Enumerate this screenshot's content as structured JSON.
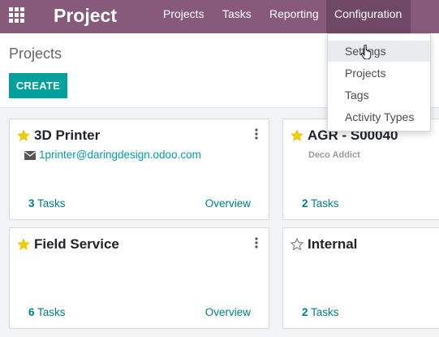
{
  "navbar": {
    "app_name": "Project",
    "menu": [
      "Projects",
      "Tasks",
      "Reporting",
      "Configuration"
    ],
    "color": "#875a7b"
  },
  "control_panel": {
    "breadcrumb": "Projects",
    "create_label": "CREATE"
  },
  "config_dropdown": {
    "items": [
      "Settings",
      "Projects",
      "Tags",
      "Activity Types"
    ],
    "hovered": "Settings"
  },
  "projects": [
    {
      "title": "3D Printer",
      "favorite": true,
      "email": "1printer@daringdesign.odoo.com",
      "partner": "",
      "task_count": "3",
      "task_word": "Tasks",
      "overview": "Overview"
    },
    {
      "title": "AGR - S00040",
      "favorite": true,
      "email": "",
      "partner": "Deco Addict",
      "task_count": "2",
      "task_word": "Tasks",
      "overview": ""
    },
    {
      "title": "Field Service",
      "favorite": true,
      "email": "",
      "partner": "",
      "task_count": "6",
      "task_word": "Tasks",
      "overview": "Overview"
    },
    {
      "title": "Internal",
      "favorite": false,
      "email": "",
      "partner": "",
      "task_count": "2",
      "task_word": "Tasks",
      "overview": ""
    }
  ],
  "colors": {
    "accent": "#00a09d",
    "link": "#017e84",
    "star": "#f3cc00"
  },
  "icons": [
    "apps-grid-icon",
    "star-icon",
    "kebab-menu-icon",
    "envelope-icon",
    "hand-pointer-icon"
  ]
}
